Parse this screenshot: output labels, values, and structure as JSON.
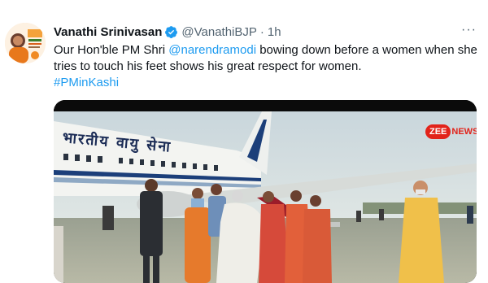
{
  "tweet": {
    "display_name": "Vanathi Srinivasan",
    "handle": "@VanathiBJP",
    "separator": "·",
    "time": "1h",
    "text_part1": "Our Hon'ble PM Shri ",
    "mention": "@narendramodi",
    "text_part2": " bowing down before a women when she tries to touch his feet shows his great respect for women.",
    "hashtag": "#PMinKashi",
    "more_label": "···"
  },
  "media": {
    "channel_badge": "ZEE",
    "channel_suffix": "NEWS",
    "aircraft_lettering": "भारतीय वायु सेना"
  },
  "colors": {
    "link": "#1d9bf0",
    "verified": "#1d9bf0",
    "secondary_text": "#536471",
    "primary_text": "#0f1419"
  },
  "icons": {
    "verified": "verified-badge-icon",
    "more": "more-options-icon"
  }
}
